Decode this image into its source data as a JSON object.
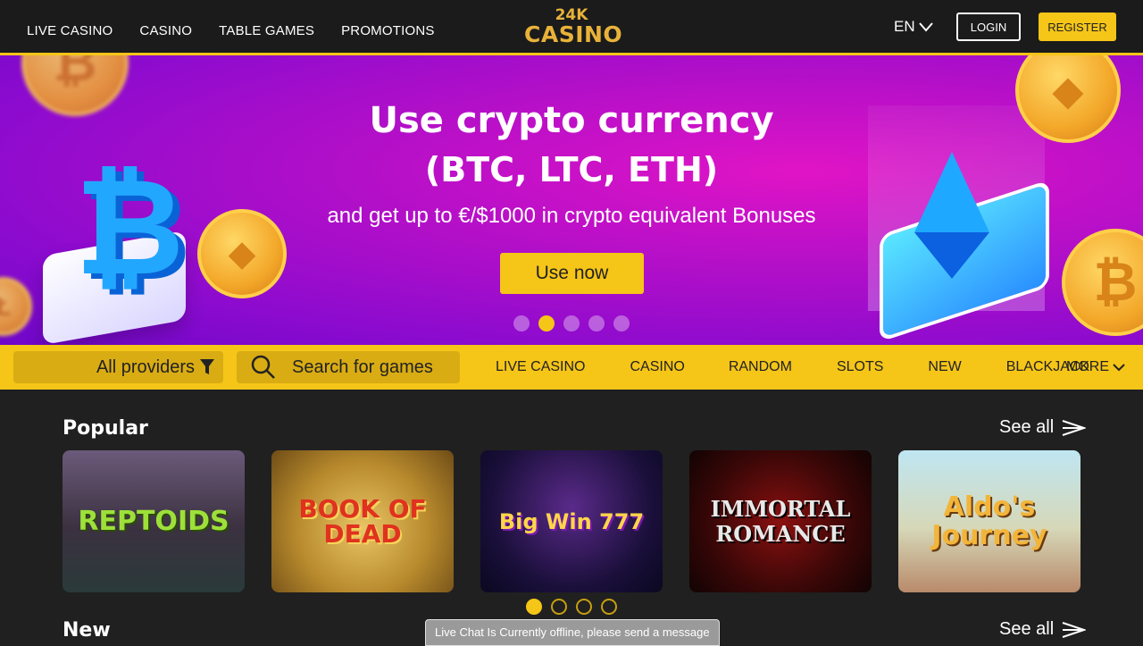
{
  "header": {
    "nav": [
      "LIVE CASINO",
      "CASINO",
      "TABLE GAMES",
      "PROMOTIONS"
    ],
    "logo_top": "24K",
    "logo_bottom": "CASINO",
    "language": "EN",
    "login_label": "LOGIN",
    "register_label": "REGISTER"
  },
  "banner": {
    "title_line1": "Use crypto currency",
    "title_line2": "(BTC, LTC, ETH)",
    "subtitle": "and get up to €/$1000 in crypto equivalent Bonuses",
    "cta_label": "Use now",
    "slide_count": 5,
    "active_slide": 2,
    "coin_labels": [
      "ETHEREUM",
      "BITCOIN"
    ]
  },
  "filterbar": {
    "providers_label": "All providers",
    "search_placeholder": "Search for games",
    "categories": [
      "LIVE CASINO",
      "CASINO",
      "RANDOM",
      "SLOTS",
      "NEW",
      "BLACKJACK"
    ],
    "more_label": "MORE"
  },
  "popular": {
    "title": "Popular",
    "see_all": "See all",
    "games": [
      "REPTOIDS",
      "BOOK OF DEAD",
      "Big Win 777",
      "IMMORTAL ROMANCE",
      "Aldo's Journey"
    ],
    "page_count": 4,
    "active_page": 1
  },
  "new_section": {
    "title": "New",
    "see_all": "See all"
  },
  "chat": {
    "text": "Live Chat Is Currently offline, please send a message"
  },
  "colors": {
    "accent": "#f5c518",
    "header_bg": "#1b1b1b",
    "page_bg": "#202020"
  }
}
